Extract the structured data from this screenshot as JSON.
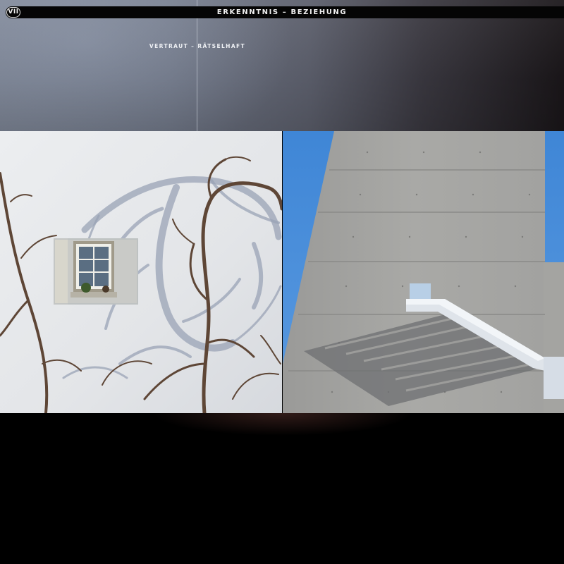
{
  "header": {
    "chapter": "VII",
    "title": "ERKENNTNIS – BEZIEHUNG"
  },
  "subtitle": "VERTRAUT – RÄTSELHAFT",
  "photos": {
    "left": {
      "subject": "white plaster wall with small window and bare vine shadows"
    },
    "right": {
      "subject": "concrete tower facade with metal stair shadow against blue sky"
    }
  },
  "colors": {
    "header_bar": "#050505",
    "header_text": "#f0f0f0",
    "sky": "#4b8cd8",
    "concrete": "#a7a7a4",
    "plaster": "#e7e8ea"
  }
}
